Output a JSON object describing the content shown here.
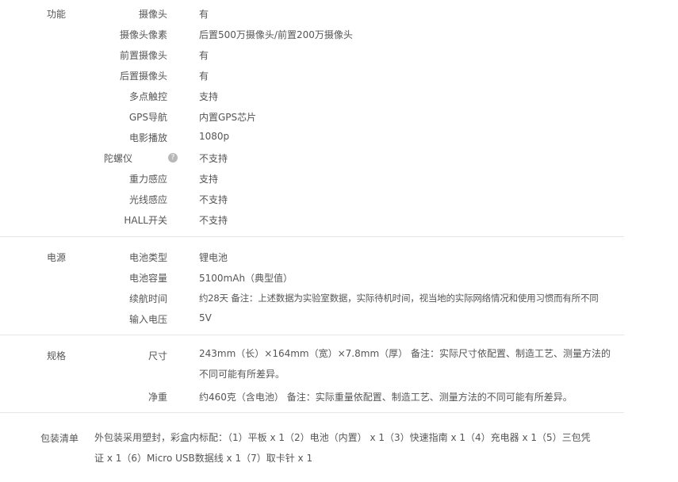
{
  "sections": [
    {
      "title": "功能",
      "rows": [
        {
          "label": "摄像头",
          "value": "有"
        },
        {
          "label": "摄像头像素",
          "value": "后置500万摄像头/前置200万摄像头"
        },
        {
          "label": "前置摄像头",
          "value": "有"
        },
        {
          "label": "后置摄像头",
          "value": "有"
        },
        {
          "label": "多点触控",
          "value": "支持"
        },
        {
          "label": "GPS导航",
          "value": "内置GPS芯片"
        },
        {
          "label": "电影播放",
          "value": "1080p"
        },
        {
          "label": "陀螺仪",
          "value": "不支持",
          "help_icon": "question-icon",
          "help_glyph": "?"
        },
        {
          "label": "重力感应",
          "value": "支持"
        },
        {
          "label": "光线感应",
          "value": "不支持"
        },
        {
          "label": "HALL开关",
          "value": "不支持"
        }
      ]
    },
    {
      "title": "电源",
      "rows": [
        {
          "label": "电池类型",
          "value": "锂电池"
        },
        {
          "label": "电池容量",
          "value": "5100mAh（典型值）"
        },
        {
          "label": "续航时间",
          "value": "约28天 备注：上述数据为实验室数据，实际待机时间，视当地的实际网络情况和使用习惯而有所不同"
        },
        {
          "label": "输入电压",
          "value": "5V"
        }
      ]
    },
    {
      "title": "规格",
      "rows": [
        {
          "label": "尺寸",
          "value": "243mm（长）×164mm（宽）×7.8mm（厚） 备注：实际尺寸依配置、制造工艺、测量方法的不同可能有所差异。"
        },
        {
          "label": "净重",
          "value": "约460克（含电池） 备注：实际重量依配置、制造工艺、测量方法的不同可能有所差异。"
        }
      ]
    }
  ],
  "package": {
    "title": "包装清单",
    "text": "外包装采用塑封，彩盒内标配：（1）平板 x 1（2）电池（内置） x 1（3）快速指南 x 1（4）充电器 x 1（5）三包凭证 x 1（6）Micro USB数据线 x 1（7）取卡针 x 1"
  }
}
